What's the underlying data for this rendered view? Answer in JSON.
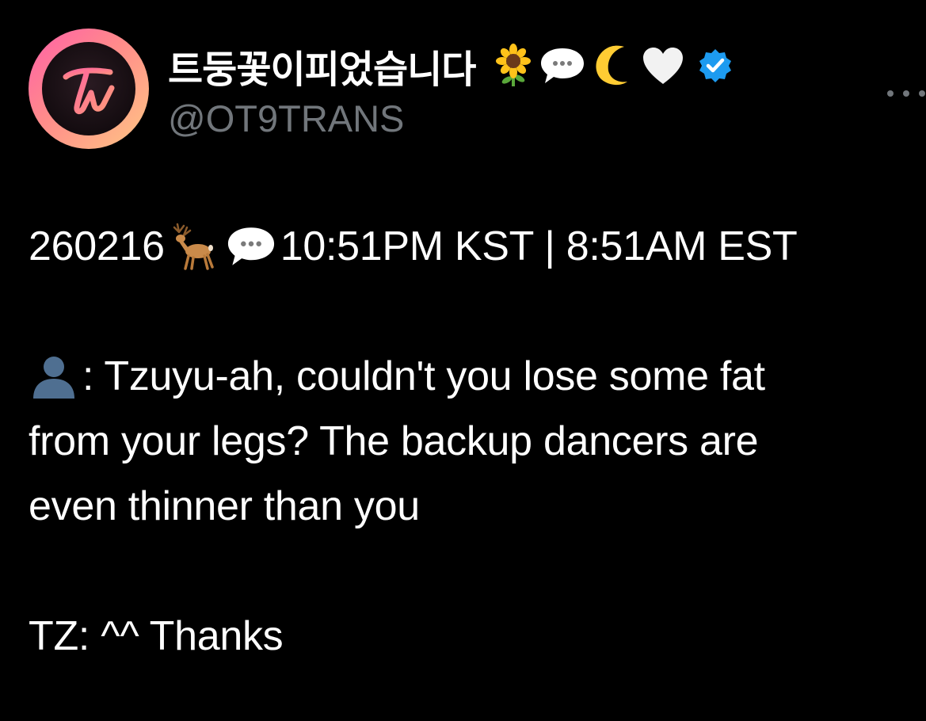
{
  "tweet": {
    "author": {
      "display_name": "트둥꽃이피었습니다",
      "handle": "@OT9TRANS",
      "name_emojis": [
        "sunflower-emoji",
        "speech-bubble-emoji",
        "crescent-moon-emoji",
        "white-heart-emoji"
      ],
      "verified": true,
      "verified_color": "#1d9bf0",
      "avatar": {
        "logo_icon": "twice-logo-icon",
        "ring_colors": [
          "#ff5fa8",
          "#ffc785"
        ]
      }
    },
    "menu": {
      "icon": "more-options-icon"
    },
    "body": {
      "line1_date": "260216",
      "line1_emojis": [
        "deer-emoji",
        "speech-bubble-emoji"
      ],
      "line1_time": "10:51PM KST | 8:51AM EST",
      "quote_emoji": "bust-silhouette-emoji",
      "quote_line1": ": Tzuyu-ah, couldn't you lose some fat",
      "quote_line2": "from your legs? The backup dancers are",
      "quote_line3": "even thinner than you",
      "reply": "TZ: ^^ Thanks"
    }
  },
  "colors": {
    "background": "#000000",
    "text": "#ffffff",
    "secondary_text": "#71767b"
  }
}
